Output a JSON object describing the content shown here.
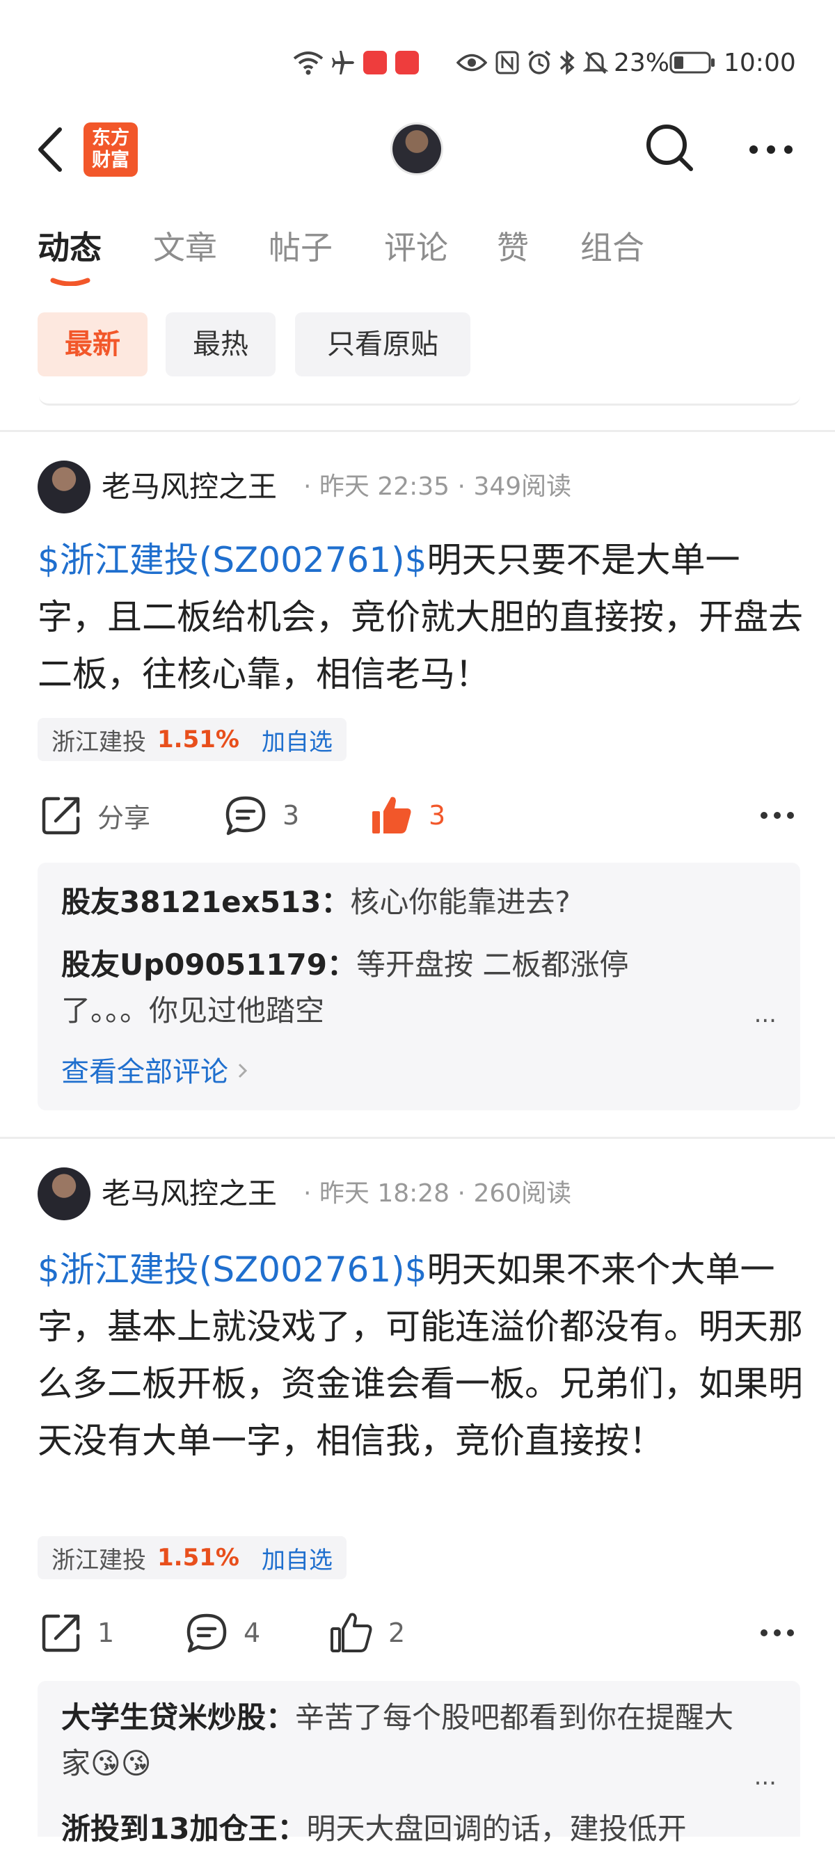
{
  "status_bar": {
    "battery": "23%",
    "time": "10:00",
    "icons": [
      "wifi-icon",
      "airplane-icon",
      "huawei-app-icon",
      "huawei-app-icon",
      "eye-icon",
      "nfc-icon",
      "alarm-icon",
      "bluetooth-icon",
      "mute-icon",
      "battery-icon"
    ]
  },
  "header": {
    "logo_line1": "东方",
    "logo_line2": "财富"
  },
  "tabs": [
    {
      "label": "动态"
    },
    {
      "label": "文章"
    },
    {
      "label": "帖子"
    },
    {
      "label": "评论"
    },
    {
      "label": "赞"
    },
    {
      "label": "组合"
    }
  ],
  "filters": [
    {
      "label": "最新"
    },
    {
      "label": "最热"
    },
    {
      "label": "只看原贴"
    }
  ],
  "accent_color": "#f2572a",
  "link_color": "#1f6fce",
  "posts": [
    {
      "author": "老马风控之王",
      "time": "昨天 22:35",
      "reads": "349阅读",
      "stock_tag": "$浙江建投(SZ002761)$",
      "text": "明天只要不是大单一字，且二板给机会，竞价就大胆的直接按，开盘去二板，往核心靠，相信老马！",
      "chip_name": "浙江建投",
      "chip_pct": "1.51%",
      "chip_add": "加自选",
      "share_label": "分享",
      "comment_count": "3",
      "like_count": "3",
      "comments": [
        {
          "user": "股友38121ex513：",
          "text": "核心你能靠进去?"
        },
        {
          "user": "股友Up09051179：",
          "text": "等开盘按 二板都涨停了。。。你见过他踏空"
        }
      ],
      "more": "...",
      "view_all": "查看全部评论"
    },
    {
      "author": "老马风控之王",
      "time": "昨天 18:28",
      "reads": "260阅读",
      "stock_tag": "$浙江建投(SZ002761)$",
      "text": "明天如果不来个大单一字，基本上就没戏了，可能连溢价都没有。明天那么多二板开板，资金谁会看一板。兄弟们，如果明天没有大单一字，相信我，竞价直接按！",
      "chip_name": "浙江建投",
      "chip_pct": "1.51%",
      "chip_add": "加自选",
      "share_count": "1",
      "comment_count": "4",
      "like_count": "2",
      "comments": [
        {
          "user": "大学生贷米炒股：",
          "text": "辛苦了每个股吧都看到你在提醒大家😘😘"
        },
        {
          "user": "浙投到13加仓王：",
          "text": "明天大盘回调的话，建投低开"
        }
      ],
      "more": "..."
    }
  ]
}
